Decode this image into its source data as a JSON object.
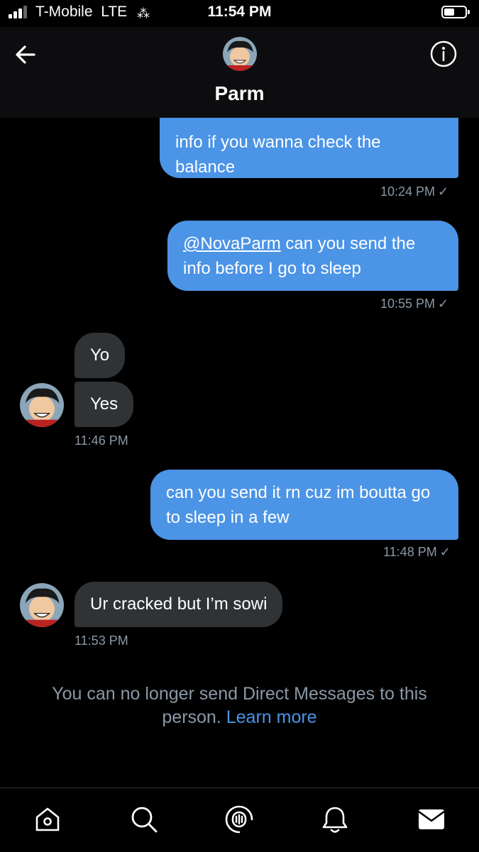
{
  "status_bar": {
    "carrier": "T-Mobile",
    "network": "LTE",
    "time": "11:54 PM"
  },
  "header": {
    "name": "Parm",
    "back_icon": "arrow-left-icon",
    "info_icon": "info-icon"
  },
  "messages": [
    {
      "type": "sent",
      "text": "info if you wanna check the balance",
      "time": "10:24 PM",
      "check": "✓"
    },
    {
      "type": "sent",
      "mention": "@NovaParm",
      "text": "can you send the info before I go to sleep",
      "time": "10:55 PM",
      "check": "✓"
    },
    {
      "type": "received",
      "text": "Yo"
    },
    {
      "type": "received",
      "text": "Yes",
      "time": "11:46 PM"
    },
    {
      "type": "sent",
      "text": "can you send it rn cuz im boutta go to sleep in a few",
      "time": "11:48 PM",
      "check": "✓"
    },
    {
      "type": "received",
      "text": "Ur cracked but I’m sowi",
      "time": "11:53 PM"
    }
  ],
  "notice": {
    "text": "You can no longer send Direct Messages to this person.",
    "link": "Learn more"
  },
  "bottom_nav": [
    {
      "icon": "home-icon"
    },
    {
      "icon": "search-icon"
    },
    {
      "icon": "spaces-icon"
    },
    {
      "icon": "notifications-icon"
    },
    {
      "icon": "messages-icon"
    }
  ],
  "colors": {
    "sent_bubble": "#4b94e6",
    "received_bubble": "#2f3336",
    "link": "#4b94e6",
    "muted_text": "#8b98a5"
  }
}
